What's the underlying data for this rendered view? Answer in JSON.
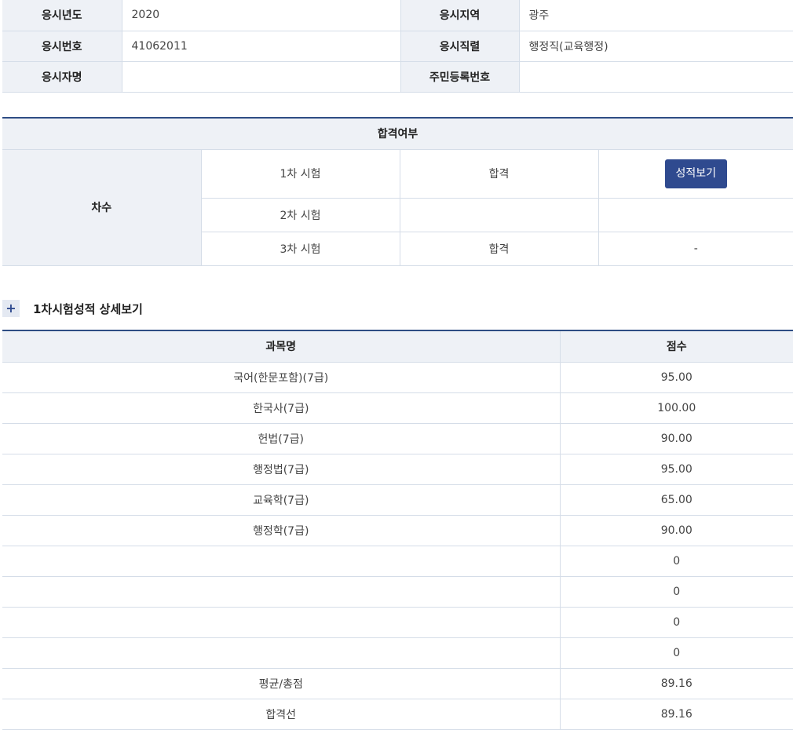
{
  "applicant_info": {
    "rows": [
      {
        "label1": "응시년도",
        "value1": "2020",
        "label2": "응시지역",
        "value2": "광주"
      },
      {
        "label1": "응시번호",
        "value1": "41062011",
        "label2": "응시직렬",
        "value2": "행정직(교육행정)"
      },
      {
        "label1": "응시자명",
        "value1": "",
        "label2": "주민등록번호",
        "value2": ""
      }
    ]
  },
  "result": {
    "header": "합격여부",
    "row_label": "차수",
    "rows": [
      {
        "stage": "1차 시험",
        "status": "합격",
        "action": "성적보기"
      },
      {
        "stage": "2차 시험",
        "status": "",
        "action": ""
      },
      {
        "stage": "3차 시험",
        "status": "합격",
        "action": "-"
      }
    ]
  },
  "detail": {
    "toggle_icon": "+",
    "title": "1차시험성적 상세보기",
    "columns": [
      "과목명",
      "점수"
    ],
    "rows": [
      {
        "subject": "국어(한문포함)(7급)",
        "score": "95.00"
      },
      {
        "subject": "한국사(7급)",
        "score": "100.00"
      },
      {
        "subject": "헌법(7급)",
        "score": "90.00"
      },
      {
        "subject": "행정법(7급)",
        "score": "95.00"
      },
      {
        "subject": "교육학(7급)",
        "score": "65.00"
      },
      {
        "subject": "행정학(7급)",
        "score": "90.00"
      },
      {
        "subject": "",
        "score": "0"
      },
      {
        "subject": "",
        "score": "0"
      },
      {
        "subject": "",
        "score": "0"
      },
      {
        "subject": "",
        "score": "0"
      },
      {
        "subject": "평균/총점",
        "score": "89.16"
      },
      {
        "subject": "합격선",
        "score": "89.16"
      }
    ]
  },
  "colors": {
    "accent": "#2f4a8f",
    "border_top": "#2e4d84",
    "label_bg": "#eef1f6",
    "grid": "#d5dde8"
  }
}
